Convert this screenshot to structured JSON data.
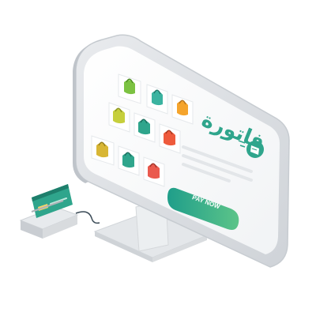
{
  "screen": {
    "brand": {
      "name": "فاتورة",
      "icon": "receipt-icon",
      "accent": "#2fa58c"
    },
    "pay_button": {
      "label": "PAY NOW",
      "gradient": [
        "#1f9e8a",
        "#5cc489"
      ]
    },
    "products": [
      {
        "name": "bag-icon",
        "color": "#7cc242"
      },
      {
        "name": "bag-icon",
        "color": "#3bb3a0"
      },
      {
        "name": "bag-icon",
        "color": "#f5a42c"
      },
      {
        "name": "bag-icon",
        "color": "#c6cf3c"
      },
      {
        "name": "bag-icon",
        "color": "#2fa58c"
      },
      {
        "name": "bag-icon",
        "color": "#ee5a3c"
      },
      {
        "name": "bag-icon",
        "color": "#d8b634"
      },
      {
        "name": "bag-icon",
        "color": "#2fa58c"
      },
      {
        "name": "bag-icon",
        "color": "#ea5a4e"
      }
    ]
  },
  "card_reader": {
    "icon": "credit-card-icon",
    "card_color": "#2fa58c"
  }
}
